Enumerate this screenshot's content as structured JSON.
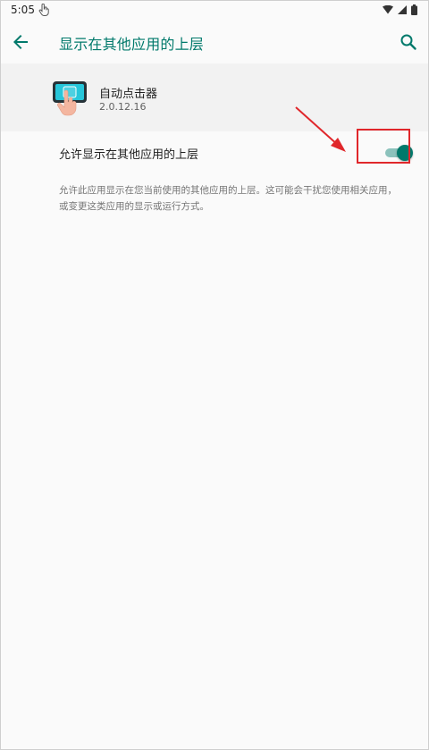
{
  "status_bar": {
    "time": "5:05"
  },
  "app_bar": {
    "title": "显示在其他应用的上层"
  },
  "app_info": {
    "name": "自动点击器",
    "version": "2.0.12.16"
  },
  "permission": {
    "label": "允许显示在其他应用的上层",
    "enabled": true,
    "description": "允许此应用显示在您当前使用的其他应用的上层。这可能会干扰您使用相关应用，或变更这类应用的显示或运行方式。"
  },
  "colors": {
    "accent": "#00796b",
    "switch_track": "#8cc2bc",
    "annotation": "#e0272b"
  },
  "icons": {
    "back": "arrow-left-icon",
    "search": "search-icon",
    "touch": "touch-hand-icon",
    "wifi": "wifi-icon",
    "signal": "signal-icon",
    "battery": "battery-icon"
  }
}
